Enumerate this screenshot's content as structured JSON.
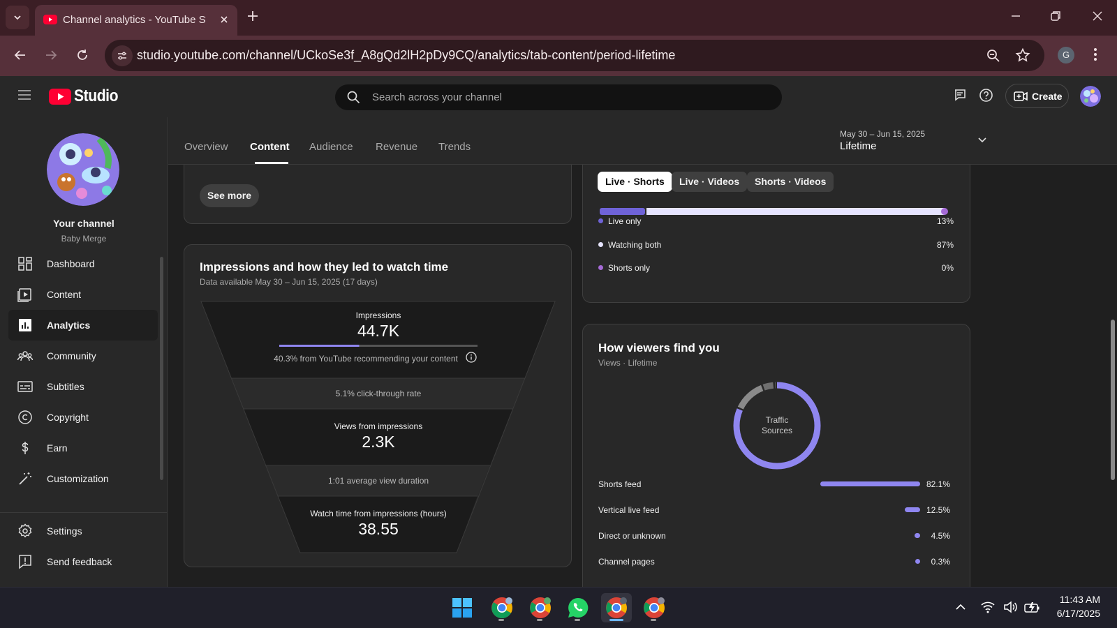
{
  "browser": {
    "tab_title": "Channel analytics - YouTube Studio",
    "url": "studio.youtube.com/channel/UCkoSe3f_A8gQd2lH2pDy9CQ/analytics/tab-content/period-lifetime",
    "profile_initial": "G"
  },
  "header": {
    "logo_text": "Studio",
    "search_placeholder": "Search across your channel",
    "create_label": "Create"
  },
  "sidebar": {
    "channel_title": "Your channel",
    "channel_name": "Baby Merge",
    "items": [
      {
        "label": "Dashboard",
        "icon": "dashboard-icon"
      },
      {
        "label": "Content",
        "icon": "content-icon"
      },
      {
        "label": "Analytics",
        "icon": "analytics-icon",
        "active": true
      },
      {
        "label": "Community",
        "icon": "community-icon"
      },
      {
        "label": "Subtitles",
        "icon": "subtitles-icon"
      },
      {
        "label": "Copyright",
        "icon": "copyright-icon"
      },
      {
        "label": "Earn",
        "icon": "earn-icon"
      },
      {
        "label": "Customization",
        "icon": "customization-icon"
      }
    ],
    "bottom_items": [
      {
        "label": "Settings",
        "icon": "gear-icon"
      },
      {
        "label": "Send feedback",
        "icon": "feedback-icon"
      }
    ]
  },
  "tabs": [
    {
      "label": "Overview"
    },
    {
      "label": "Content",
      "active": true
    },
    {
      "label": "Audience"
    },
    {
      "label": "Revenue"
    },
    {
      "label": "Trends"
    }
  ],
  "date_range": {
    "range": "May 30 – Jun 15, 2025",
    "period": "Lifetime"
  },
  "content": {
    "see_more_label": "See more",
    "funnel": {
      "title": "Impressions and how they led to watch time",
      "subtitle": "Data available May 30 – Jun 15, 2025 (17 days)",
      "impressions_label": "Impressions",
      "impressions_value": "44.7K",
      "recommend_text": "40.3% from YouTube recommending your content",
      "recommend_fraction": 0.403,
      "ctr_text": "5.1% click-through rate",
      "views_label": "Views from impressions",
      "views_value": "2.3K",
      "avd_text": "1:01 average view duration",
      "watch_label": "Watch time from impressions (hours)",
      "watch_value": "38.55"
    },
    "overlap": {
      "chips": [
        "Live · Shorts",
        "Live · Videos",
        "Shorts · Videos"
      ],
      "active_chip": 0,
      "rows": [
        {
          "label": "Live only",
          "value": "13%",
          "fraction": 0.13,
          "color": "#6f63d8"
        },
        {
          "label": "Watching both",
          "value": "87%",
          "fraction": 0.87,
          "color": "#e6e4ff"
        },
        {
          "label": "Shorts only",
          "value": "0%",
          "fraction": 0.0,
          "color": "#a56ad6"
        }
      ]
    },
    "traffic": {
      "title": "How viewers find you",
      "subtitle": "Views · Lifetime",
      "donut_label_1": "Traffic",
      "donut_label_2": "Sources",
      "accent": "#8f86f0",
      "sources": [
        {
          "label": "Shorts feed",
          "value": "82.1%",
          "fraction": 0.821
        },
        {
          "label": "Vertical live feed",
          "value": "12.5%",
          "fraction": 0.125
        },
        {
          "label": "Direct or unknown",
          "value": "4.5%",
          "fraction": 0.045
        },
        {
          "label": "Channel pages",
          "value": "0.3%",
          "fraction": 0.003
        }
      ]
    }
  },
  "taskbar": {
    "apps": [
      "windows-start-icon",
      "chrome-icon",
      "chrome-icon",
      "whatsapp-icon",
      "chrome-icon",
      "chrome-icon"
    ],
    "active_app": 4,
    "time": "11:43 AM",
    "date": "6/17/2025"
  }
}
